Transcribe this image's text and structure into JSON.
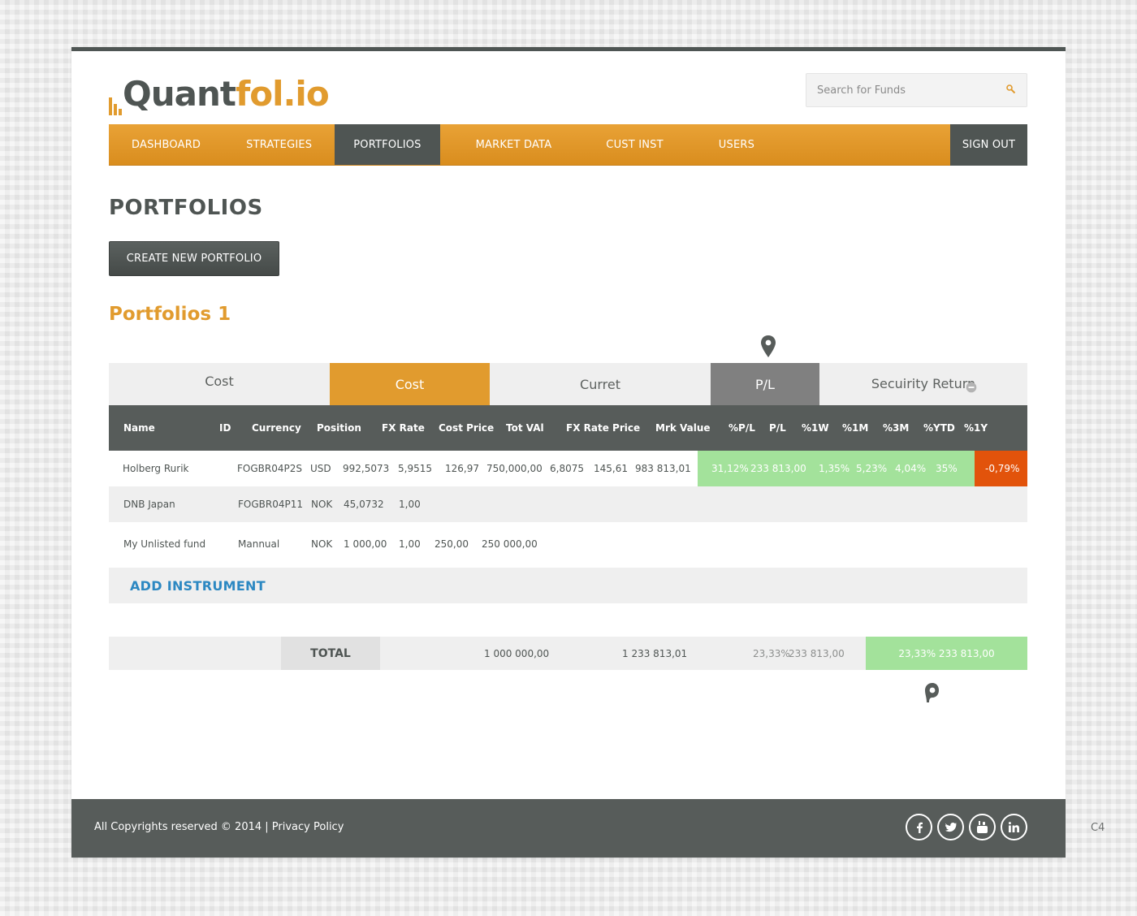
{
  "brand": {
    "logo_part1": "Quant",
    "logo_part2": "fol.io"
  },
  "search": {
    "placeholder": "Search for Funds"
  },
  "nav": {
    "items": [
      {
        "label": "DASHBOARD"
      },
      {
        "label": "STRATEGIES"
      },
      {
        "label": "PORTFOLIOS",
        "active": true
      },
      {
        "label": "MARKET DATA"
      },
      {
        "label": "CUST INST"
      },
      {
        "label": "USERS"
      }
    ],
    "sign_out": "SIGN OUT"
  },
  "page": {
    "title": "PORTFOLIOS",
    "create_button": "CREATE NEW PORTFOLIO",
    "section_title": "Portfolios 1"
  },
  "tabs": [
    "Cost",
    "Cost",
    "Curret",
    "P/L",
    "Secuirity Return"
  ],
  "table": {
    "headers": [
      "Name",
      "ID",
      "Currency",
      "Position",
      "FX Rate",
      "Cost Price",
      "Tot VAl",
      "FX Rate Price",
      "Mrk Value",
      "%P/L",
      "P/L",
      "%1W",
      "%1M",
      "%3M",
      "%YTD",
      "%1Y"
    ],
    "rows": [
      {
        "name": "Holberg Rurik",
        "id": "FOGBR04P2S",
        "currency": "USD",
        "position": "992,5073",
        "fx_rate": "5,9515",
        "cost_price": "126,97",
        "tot_val": "750,000,00",
        "fx_rate_price": "6,8075",
        "price": "145,61",
        "mrk_value": "983 813,01",
        "pct_pl": "31,12%",
        "pl": "233 813,00",
        "w1": "1,35%",
        "m1": "5,23%",
        "m3": "4,04%",
        "ytd": "35%",
        "y1": "-0,79%"
      },
      {
        "name": "DNB Japan",
        "id": "FOGBR04P11",
        "currency": "NOK",
        "position": "45,0732",
        "fx_rate": "1,00"
      },
      {
        "name": "My Unlisted fund",
        "id": "Mannual",
        "currency": "NOK",
        "position": "1 000,00",
        "fx_rate": "1,00",
        "cost_price": "250,00",
        "tot_val": "250 000,00"
      }
    ],
    "add_instrument": "ADD INSTRUMENT",
    "total": {
      "label": "TOTAL",
      "tot_val": "1 000 000,00",
      "mrk_value": "1 233 813,01",
      "pct_pl": "23,33%",
      "pl": "233 813,00",
      "highlight": "23,33% 233 813,00"
    }
  },
  "footer": {
    "copyright": "All Copyrights reserved © 2014 |",
    "privacy": "Privacy Policy",
    "social": [
      "facebook-icon",
      "twitter-icon",
      "youtube-icon",
      "linkedin-icon"
    ]
  },
  "corner_label": "C4",
  "colors": {
    "accent": "#e19b2e",
    "dark": "#575c5a",
    "positive": "#a3e29b",
    "negative": "#e2530b",
    "link": "#2c88c2"
  }
}
